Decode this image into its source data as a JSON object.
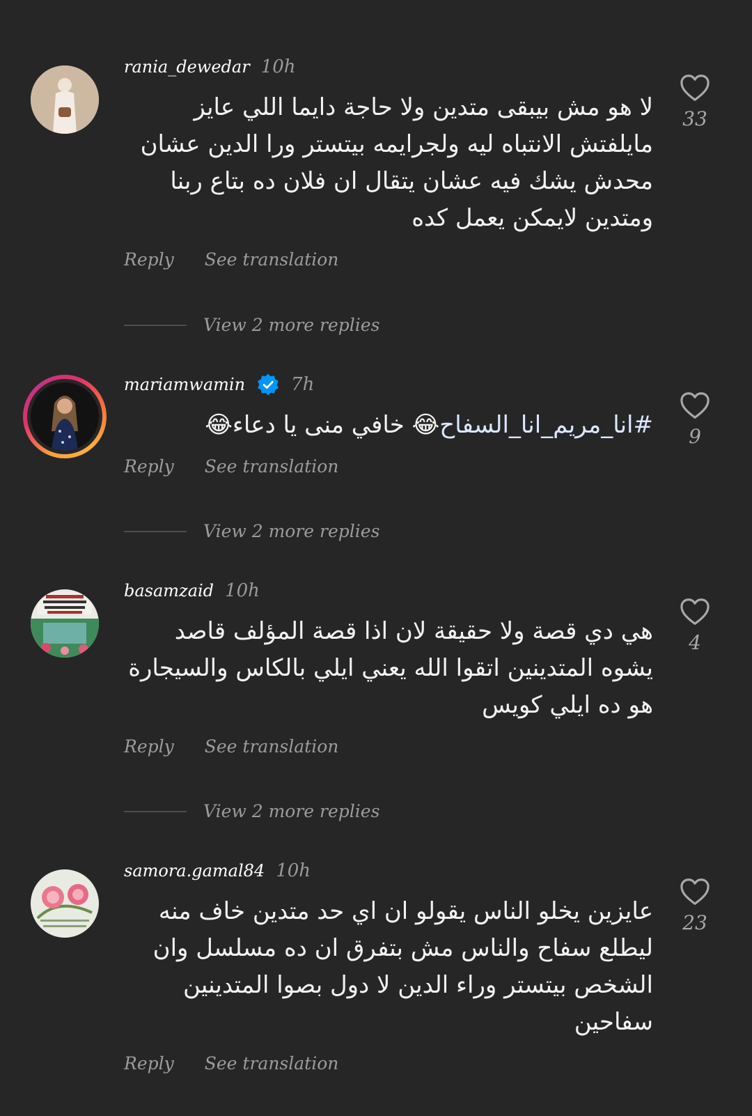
{
  "comments": [
    {
      "username": "rania_dewedar",
      "time": "10h",
      "verified": false,
      "text": "لا هو مش بيبقى متدين ولا حاجة دايما اللي عايز مايلفتش الانتباه ليه ولجرايمه بيتستر ورا الدين عشان محدش يشك فيه عشان يتقال ان فلان ده بتاع ربنا ومتدين لايمكن يعمل كده",
      "likes": "33",
      "reply_label": "Reply",
      "translate_label": "See translation",
      "view_replies": "View 2 more replies"
    },
    {
      "username": "mariamwamin",
      "time": "7h",
      "verified": true,
      "hashtag": "#انا_مريم_انا_السفاح",
      "text_rest": "😂 خافي منى يا دعاء😂",
      "likes": "9",
      "reply_label": "Reply",
      "translate_label": "See translation",
      "view_replies": "View 2 more replies"
    },
    {
      "username": "basamzaid",
      "time": "10h",
      "verified": false,
      "text": "هي دي قصة ولا حقيقة لان اذا قصة المؤلف قاصد يشوه المتدينين اتقوا الله يعني ايلي بالكاس والسيجارة هو ده ايلي كويس",
      "likes": "4",
      "reply_label": "Reply",
      "translate_label": "See translation",
      "view_replies": "View 2 more replies"
    },
    {
      "username": "samora.gamal84",
      "time": "10h",
      "verified": false,
      "text": "عايزين يخلو الناس يقولو ان اي حد متدين خاف منه ليطلع سفاح والناس مش بتفرق ان ده مسلسل وان الشخص بيتستر وراء الدين لا دول بصوا المتدينين سفاحين",
      "likes": "23",
      "reply_label": "Reply",
      "translate_label": "See translation"
    }
  ],
  "icons": {
    "like": "heart-outline-icon",
    "verified": "verified-badge-icon"
  },
  "colors": {
    "background": "#262626",
    "verified": "#0095f6",
    "muted": "#9c9c9c"
  }
}
